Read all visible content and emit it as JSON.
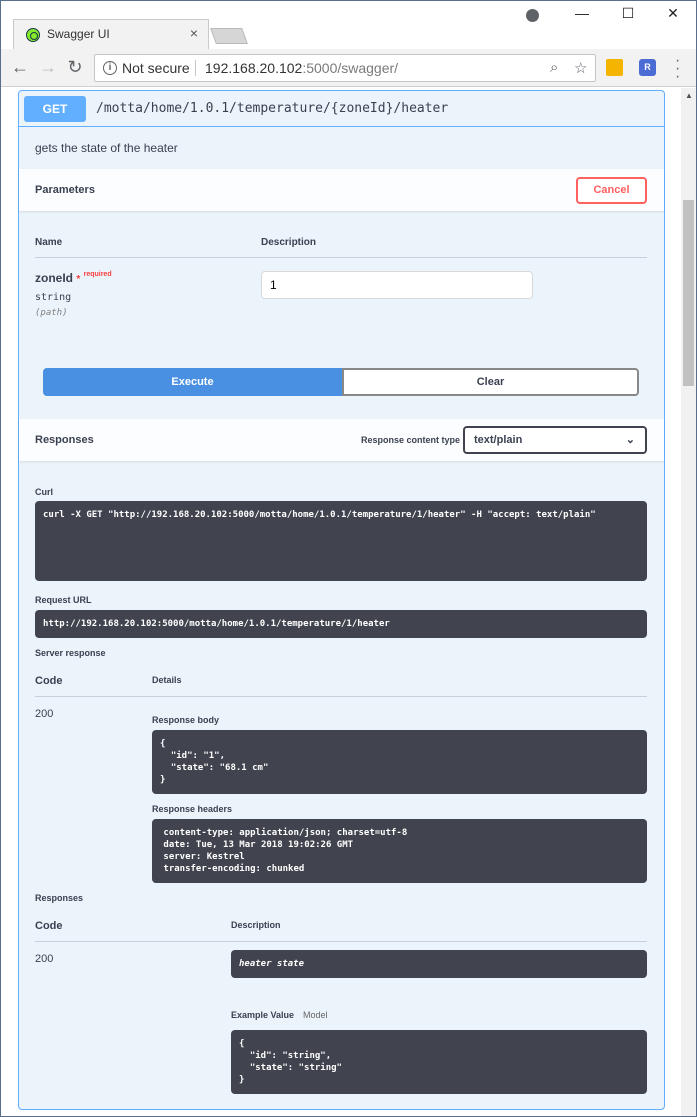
{
  "browser": {
    "tab_title": "Swagger UI",
    "tab_close": "×",
    "url_security": "Not secure",
    "url_host": "192.168.20.102",
    "url_rest": ":5000/swagger/",
    "win_minimize": "—",
    "win_maximize": "☐",
    "win_close": "✕",
    "ext_r_label": "R"
  },
  "operation": {
    "method": "GET",
    "path": "/motta/home/1.0.1/temperature/{zoneId}/heater",
    "description": "gets the state of the heater"
  },
  "parameters": {
    "title": "Parameters",
    "cancel_label": "Cancel",
    "col_name": "Name",
    "col_description": "Description",
    "param": {
      "name": "zoneId",
      "required_star": "*",
      "required_label": "required",
      "type": "string",
      "in": "(path)",
      "value": "1"
    },
    "execute_label": "Execute",
    "clear_label": "Clear"
  },
  "responses_header": {
    "title": "Responses",
    "content_type_label": "Response content type",
    "content_type_value": "text/plain"
  },
  "live": {
    "curl_title": "Curl",
    "curl_command": "curl -X GET \"http://192.168.20.102:5000/motta/home/1.0.1/temperature/1/heater\" -H \"accept: text/plain\"",
    "request_url_title": "Request URL",
    "request_url": "http://192.168.20.102:5000/motta/home/1.0.1/temperature/1/heater",
    "server_response_title": "Server response",
    "col_code": "Code",
    "col_details": "Details",
    "code": "200",
    "response_body_title": "Response body",
    "response_body": "{\n  \"id\": \"1\",\n  \"state\": \"68.1 cm\"\n}",
    "response_headers_title": "Response headers",
    "response_headers": " content-type: application/json; charset=utf-8\n date: Tue, 13 Mar 2018 19:02:26 GMT\n server: Kestrel\n transfer-encoding: chunked"
  },
  "documented": {
    "title": "Responses",
    "col_code": "Code",
    "col_description": "Description",
    "code": "200",
    "description": "heater state",
    "example_value_tab": "Example Value",
    "model_tab": "Model",
    "example": "{\n  \"id\": \"string\",\n  \"state\": \"string\"\n}"
  },
  "colors": {
    "get_accent": "#61affe",
    "execute": "#4990e2",
    "cancel": "#ff6060",
    "code_bg": "#41444e"
  }
}
